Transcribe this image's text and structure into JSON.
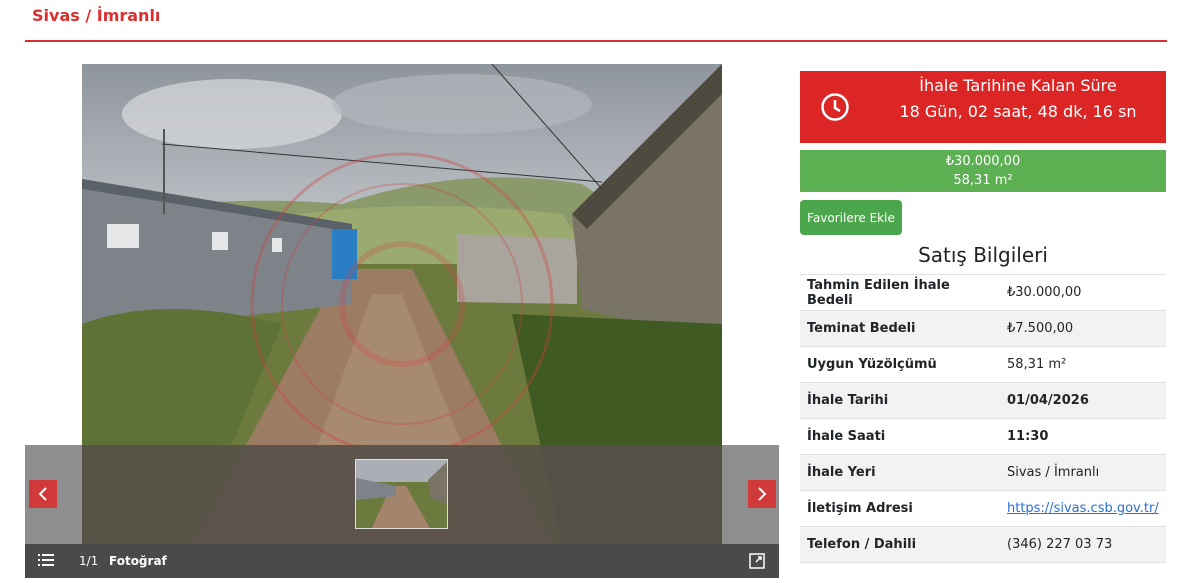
{
  "location": "Sivas / İmranlı",
  "gallery": {
    "counter": "1/1",
    "photo_type": "Fotoğraf",
    "prev_icon": "chevron-left-icon",
    "next_icon": "chevron-right-icon"
  },
  "timer": {
    "title": "İhale Tarihine Kalan Süre",
    "value": "18 Gün, 02 saat, 48 dk, 16 sn",
    "icon": "clock-icon"
  },
  "price": {
    "amount": "₺30.000,00",
    "area": "58,31 m²"
  },
  "favorite_button": "Favorilere Ekle",
  "sales": {
    "heading": "Satış Bilgileri",
    "rows": [
      {
        "label": "Tahmin Edilen İhale Bedeli",
        "value": "₺30.000,00"
      },
      {
        "label": "Teminat Bedeli",
        "value": "₺7.500,00"
      },
      {
        "label": "Uygun Yüzölçümü",
        "value": "58,31 m²"
      },
      {
        "label": "İhale Tarihi",
        "value": "01/04/2026"
      },
      {
        "label": "İhale Saati",
        "value": "11:30"
      },
      {
        "label": "İhale Yeri",
        "value": "Sivas / İmranlı"
      },
      {
        "label": "İletişim Adresi",
        "value": "https://sivas.csb.gov.tr/"
      },
      {
        "label": "Telefon / Dahili",
        "value": "(346) 227 03 73"
      }
    ]
  },
  "colors": {
    "brand_red": "#dc2626",
    "price_green": "#5cb052",
    "button_green": "#4ca64c"
  }
}
